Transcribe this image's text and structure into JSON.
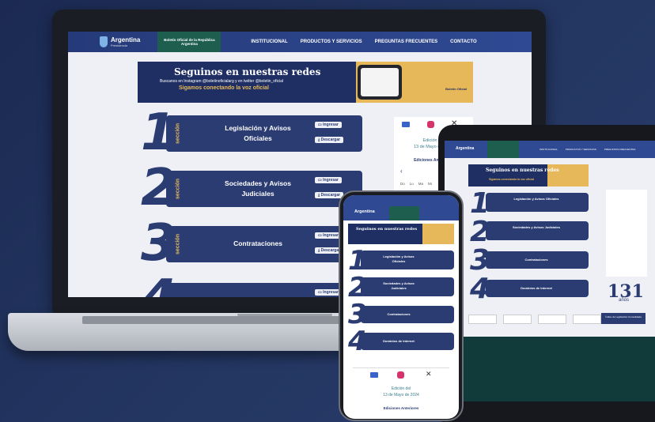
{
  "site": {
    "logo": {
      "name": "Argentina",
      "sub": "Presidencia"
    },
    "boletin": "Boletín Oficial de la República Argentina",
    "nav": [
      "INSTITUCIONAL",
      "PRODUCTOS Y SERVICIOS",
      "PREGUNTAS FRECUENTES",
      "CONTACTO"
    ]
  },
  "banner": {
    "title": "Seguinos en nuestras redes",
    "sub": "Buscanos en Instagram @boletinoficialarg y en twitter @boletin_oficial",
    "sub2": "Sigamos conectando la voz oficial",
    "badge": "Boletín Oficial"
  },
  "sections": [
    {
      "num": "1",
      "word": "sección",
      "title": "Legislación y Avisos Oficiales",
      "btn1": "Ingresar",
      "btn2": "Descargar"
    },
    {
      "num": "2",
      "word": "sección",
      "title": "Sociedades y Avisos Judiciales",
      "btn1": "Ingresar",
      "btn2": "Descargar"
    },
    {
      "num": "3",
      "word": "sección",
      "title": "Contrataciones",
      "btn1": "Ingresar",
      "btn2": "Descargar"
    },
    {
      "num": "4",
      "word": "sección",
      "title": "Dominios de Internet",
      "btn1": "Ingresar",
      "btn2": "Descargar"
    }
  ],
  "panel": {
    "edition": "Edición del",
    "edition_date": "13 de Mayo de 2024",
    "prev": "Ediciones Anteriores",
    "weekdays": [
      "Do",
      "Lu",
      "Ma",
      "Mi"
    ]
  },
  "tablet": {
    "years": "131",
    "years_sub": "años",
    "cta": "Índice de Legislación Consolidada"
  },
  "colors": {
    "navy": "#2b3c73",
    "gold": "#e6b85a",
    "green": "#1d5e4f"
  }
}
